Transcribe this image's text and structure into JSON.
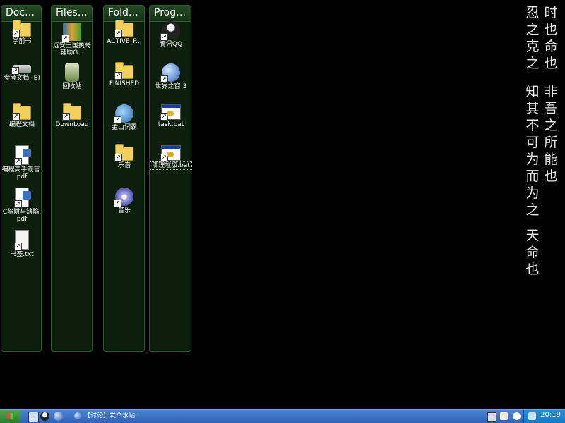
{
  "panels": [
    {
      "title": "Docu...",
      "items": [
        {
          "label": "学前书",
          "icon": "folder-icon"
        },
        {
          "label": "参考文档 (E)",
          "icon": "drive-icon"
        },
        {
          "label": "编程文档",
          "icon": "folder-icon"
        },
        {
          "label": "编程高手箴言.pdf",
          "icon": "pdf-icon"
        },
        {
          "label": "C陷阱与缺陷.pdf",
          "icon": "pdf-icon"
        },
        {
          "label": "书签.txt",
          "icon": "text-file-icon"
        }
      ]
    },
    {
      "title": "Files &...",
      "items": [
        {
          "label": "远安王国执哥辅助G...",
          "icon": "books-icon"
        },
        {
          "label": "回收站",
          "icon": "recycle-bin-icon"
        },
        {
          "label": "DownLoad",
          "icon": "folder-icon"
        }
      ]
    },
    {
      "title": "Folders",
      "items": [
        {
          "label": "ACTIVE_P...",
          "icon": "folder-icon"
        },
        {
          "label": "FINISHED",
          "icon": "folder-icon"
        },
        {
          "label": "金山词霸",
          "icon": "dictionary-icon"
        },
        {
          "label": "乐谱",
          "icon": "folder-icon"
        },
        {
          "label": "音乐",
          "icon": "music-disc-icon"
        }
      ]
    },
    {
      "title": "Progra...",
      "items": [
        {
          "label": "腾讯QQ",
          "icon": "qq-penguin-icon"
        },
        {
          "label": "世界之窗 3",
          "icon": "browser-globe-icon"
        },
        {
          "label": "task.bat",
          "icon": "batch-file-icon"
        },
        {
          "label": "清理垃圾.bat",
          "icon": "batch-file-icon"
        }
      ]
    }
  ],
  "poem_columns": [
    "时也命也",
    "忍之克之",
    "非吾之所能也",
    "知其不可为而为之",
    "天命也"
  ],
  "taskbar": {
    "active_window": "【讨论】发个水贴...",
    "clock": "20:19"
  }
}
